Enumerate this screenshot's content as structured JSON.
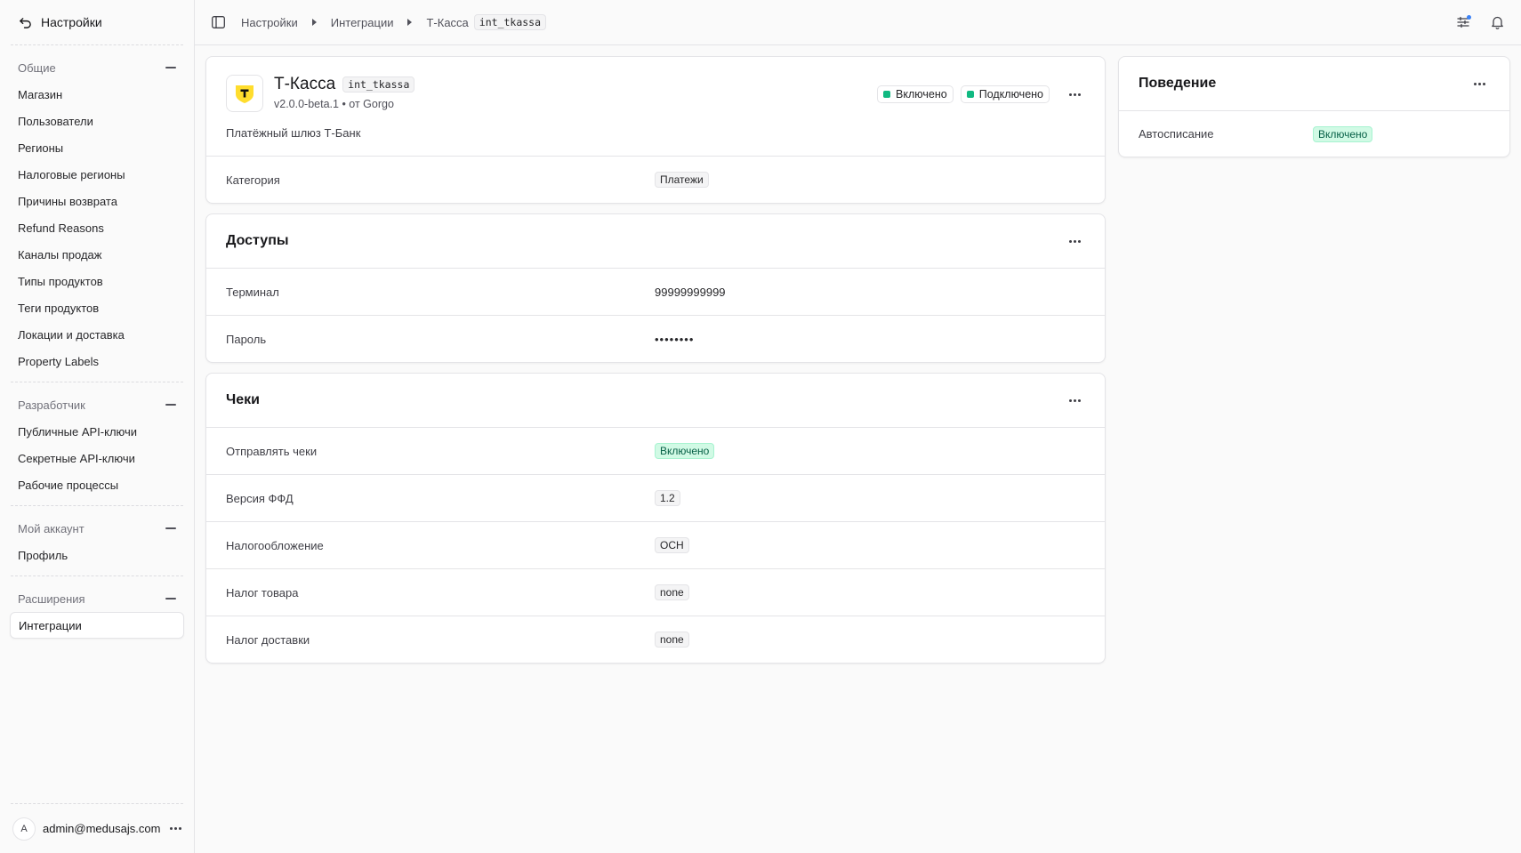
{
  "sidebar": {
    "title": "Настройки",
    "sections": [
      {
        "name": "Общие",
        "items": [
          "Магазин",
          "Пользователи",
          "Регионы",
          "Налоговые регионы",
          "Причины возврата",
          "Refund Reasons",
          "Каналы продаж",
          "Типы продуктов",
          "Теги продуктов",
          "Локации и доставка",
          "Property Labels"
        ]
      },
      {
        "name": "Разработчик",
        "items": [
          "Публичные API-ключи",
          "Секретные API-ключи",
          "Рабочие процессы"
        ]
      },
      {
        "name": "Мой аккаунт",
        "items": [
          "Профиль"
        ]
      },
      {
        "name": "Расширения",
        "items": [
          "Интеграции"
        ]
      }
    ],
    "user": {
      "initial": "A",
      "email": "admin@medusajs.com"
    }
  },
  "breadcrumb": {
    "items": [
      "Настройки",
      "Интеграции",
      "Т-Касса"
    ],
    "tag": "int_tkassa"
  },
  "integration": {
    "name": "Т-Касса",
    "id": "int_tkassa",
    "version": "v2.0.0-beta.1 • от Gorgo",
    "status_enabled": "Включено",
    "status_connected": "Подключено",
    "description": "Платёжный шлюз Т-Банк",
    "category_label": "Категория",
    "category_value": "Платежи",
    "logo_letter": "T"
  },
  "access": {
    "title": "Доступы",
    "terminal_label": "Терминал",
    "terminal_value": "99999999999",
    "password_label": "Пароль",
    "password_value": "••••••••"
  },
  "receipts": {
    "title": "Чеки",
    "rows": [
      {
        "label": "Отправлять чеки",
        "value": "Включено",
        "green": true
      },
      {
        "label": "Версия ФФД",
        "value": "1.2"
      },
      {
        "label": "Налогообложение",
        "value": "ОСН"
      },
      {
        "label": "Налог товара",
        "value": "none"
      },
      {
        "label": "Налог доставки",
        "value": "none"
      }
    ]
  },
  "behavior": {
    "title": "Поведение",
    "autocharge_label": "Автосписание",
    "autocharge_value": "Включено"
  },
  "colors": {
    "accent_green": "#10b981",
    "notification_dot": "#3b82f6",
    "logo_yellow": "#ffdd2d"
  }
}
